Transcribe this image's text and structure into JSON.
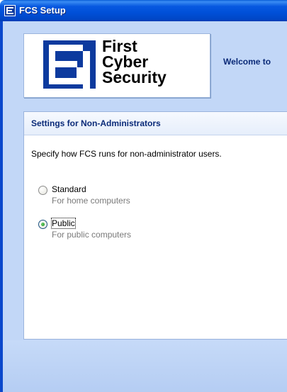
{
  "window": {
    "title": "FCS Setup",
    "app_icon": "fcs-logo-icon"
  },
  "header": {
    "logo_lines": [
      "First",
      "Cyber",
      "Security"
    ],
    "welcome_text": "Welcome to"
  },
  "settings": {
    "title": "Settings for Non-Administrators",
    "description": "Specify how FCS runs for non-administrator users.",
    "options": [
      {
        "label": "Standard",
        "sublabel": "For home computers",
        "selected": false
      },
      {
        "label": "Public",
        "sublabel": "For public computers",
        "selected": true
      }
    ]
  },
  "colors": {
    "titlebar": "#0050d8",
    "client_background": "#c2d7f7",
    "heading_text": "#0a2a78",
    "logo_blue": "#0c3a9e",
    "radio_selected": "#21a121"
  }
}
